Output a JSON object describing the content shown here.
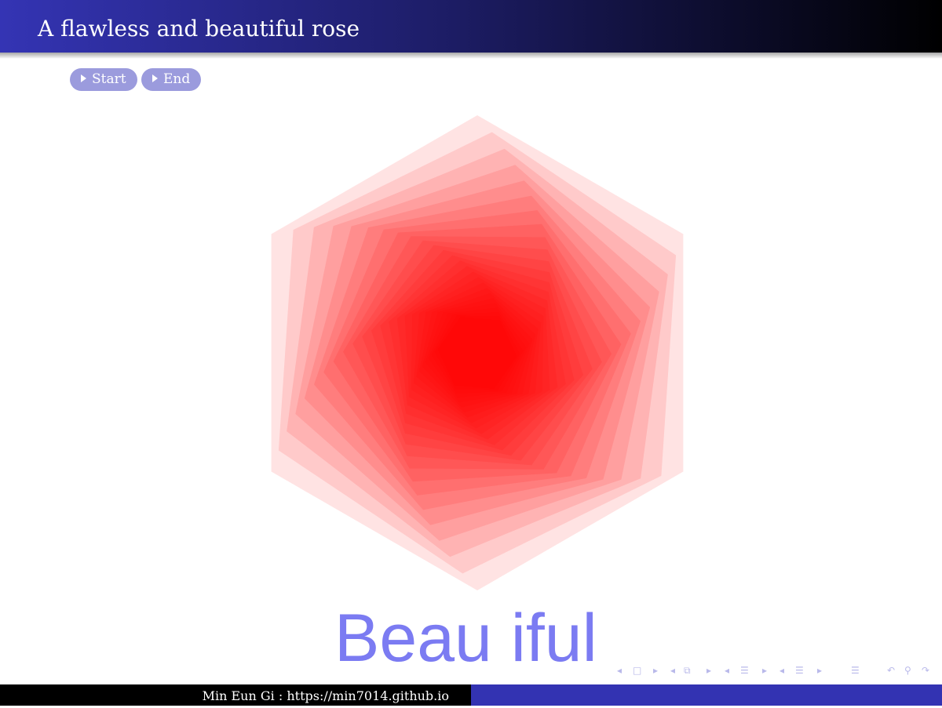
{
  "slide": {
    "title": "A flawless and beautiful rose",
    "buttons": [
      {
        "label": "Start"
      },
      {
        "label": "End"
      }
    ],
    "big_text": "Beau iful",
    "footer_text": "Min Eun Gi : https://min7014.github.io"
  },
  "graphic": {
    "shape": "hexagon",
    "layers": 26,
    "rotation_per_layer_deg": 3.8,
    "fill_color": "#ff0000",
    "layer_opacity": 0.11,
    "description_icon": "rose-icon"
  },
  "navigation_icons": [
    "nav-prev-frame-icon",
    "nav-frame-icon",
    "nav-next-frame-icon",
    "nav-prev-subsection-icon",
    "nav-subsection-icon",
    "nav-next-subsection-icon",
    "nav-prev-section-icon",
    "nav-section-icon",
    "nav-next-section-icon",
    "nav-prev-slide-icon",
    "nav-slide-icon",
    "nav-next-slide-icon",
    "nav-document-icon",
    "nav-back-icon",
    "nav-search-icon",
    "nav-forward-icon"
  ],
  "colors": {
    "header_start": "#3434b4",
    "header_end": "#000000",
    "button_bg": "#9b9bdd",
    "big_text": "#7b7bf2",
    "footer_left": "#000000",
    "footer_right": "#3333b2",
    "nav_icons": "#b9b9ea"
  }
}
